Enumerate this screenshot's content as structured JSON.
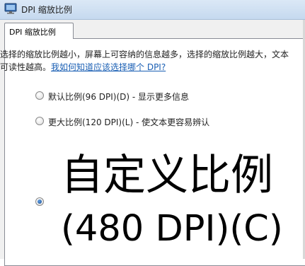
{
  "window": {
    "title": "DPI 缩放比例"
  },
  "tab": {
    "label": "DPI 缩放比例"
  },
  "description": {
    "line1": "选择的缩放比例越小，屏幕上可容纳的信息越多，选择的缩放比例越大，文本",
    "line2_prefix": "可读性越高。",
    "help_link": "我如何知道应该选择哪个 DPI?"
  },
  "options": [
    {
      "label": "默认比例(96 DPI)(D) - 显示更多信息",
      "selected": false
    },
    {
      "label": "更大比例(120 DPI)(L) - 使文本更容易辨认",
      "selected": false
    },
    {
      "label_line1": "自定义比例",
      "label_line2": "(480 DPI)(C)",
      "selected": true
    }
  ],
  "icons": {
    "window_icon": "monitor-icon"
  }
}
